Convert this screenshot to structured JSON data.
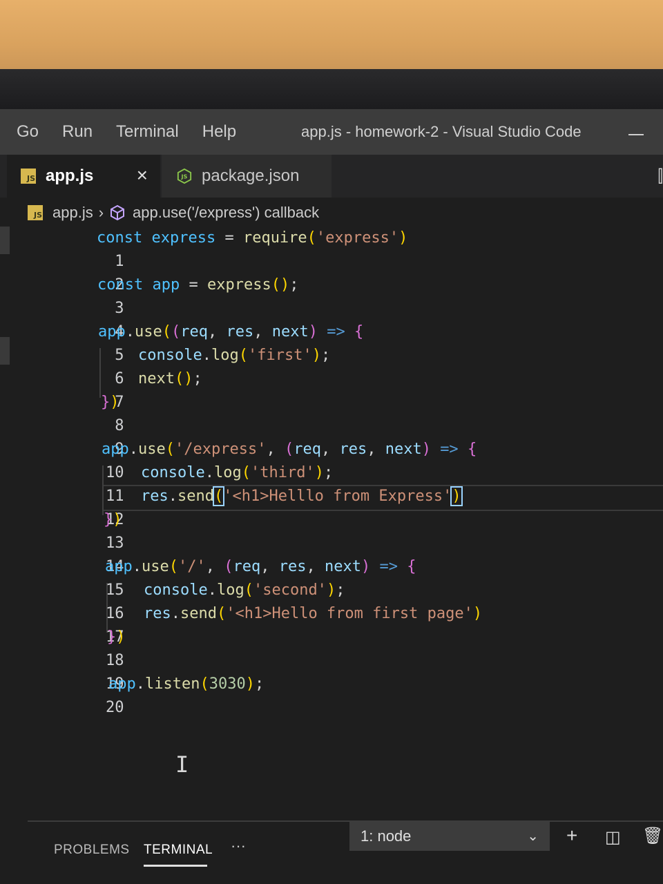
{
  "menu": {
    "items": [
      "Go",
      "Run",
      "Terminal",
      "Help"
    ]
  },
  "window_title": "app.js - homework-2 - Visual Studio Code",
  "tabs": [
    {
      "label": "app.js",
      "icon": "js-file-icon",
      "active": true,
      "close": "×"
    },
    {
      "label": "package.json",
      "icon": "nodejs-icon",
      "active": false
    }
  ],
  "breadcrumb": {
    "file": "app.js",
    "symbol": "app.use('/express') callback"
  },
  "editor": {
    "line_numbers": [
      "1",
      "2",
      "3",
      "4",
      "5",
      "6",
      "7",
      "8",
      "9",
      "10",
      "11",
      "12",
      "13",
      "14",
      "15",
      "16",
      "17",
      "18",
      "19",
      "20"
    ],
    "code_lines": [
      "const express = require('express')",
      "",
      "const app = express();",
      "",
      "app.use((req, res, next) => {",
      "    console.log('first');",
      "    next();",
      "})",
      "",
      "app.use('/express', (req, res, next) => {",
      "    console.log('third');",
      "    res.send('<h1>Helllo from Express')",
      "})",
      "",
      "app.use('/', (req, res, next) => {",
      "    console.log('second');",
      "    res.send('<h1>Hello from first page')",
      "})",
      "",
      "app.listen(3030);"
    ]
  },
  "panel": {
    "tabs": [
      "PROBLEMS",
      "TERMINAL"
    ],
    "active_tab": "TERMINAL",
    "more": "···",
    "terminal_select": "1: node"
  },
  "colors": {
    "keyword": "#4fc1ff",
    "function": "#dcdcaa",
    "string": "#ce9178",
    "bracket": "#ffd700",
    "bracket_nested": "#da70d6",
    "editor_bg": "#1e1e1e"
  }
}
